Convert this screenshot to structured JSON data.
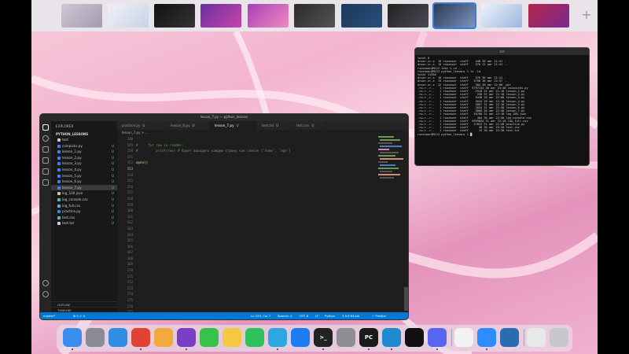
{
  "spaces": {
    "add_label": "+"
  },
  "terminal": {
    "title": "zsh",
    "lines": [
      "total 0",
      "drwxr-xr-x  16 rsoznoar  staff    448 30 авг 21:41 .",
      "drwxr-xr-x  15 rsoznoar  staff    576 31 авг 21:41 ..",
      "rsoznoar@ML12 test % cd ..",
      "rsoznoar@ML12 python_lessons % ls -la",
      "total 11384",
      "drwxr-xr-x  16 rsoznoar  staff    576 30 авг 21:41 .",
      "drwxr-xr-x  15 rsoznoar  staff   3758 30 авг 22:57 ..",
      "drwxr-xr-x  12 rsoznoar  staff    384 30 авг 22:08 .git",
      "-rw-r--r--   1 rsoznoar  staff  5797144 30 авг 23:40 coinpicks.py",
      "-rw-r--r--   1 rsoznoar  staff    1918 31 авг 21:18 lesson_1.py",
      "-rw-r--r--   1 rsoznoar  staff     258 31 авг 21:18 lesson_2.py",
      "-rw-r--r--   1 rsoznoar  staff    9448 29 авг 22:08 lesson_3.py",
      "-rw-r--r--   1 rsoznoar  staff    5044 29 авг 22:18 lesson_4.py",
      "-rw-r--r--   1 rsoznoar  staff    5067 31 авг 22:18 lesson_5.py",
      "-rw-r--r--   1 rsoznoar  staff    2834 31 авг 22:58 lesson_6.py",
      "-rw-r--r--   1 rsoznoar  staff    5800 30 авг 22:48 lesson_7.py",
      "-rw-r--r--   1 rsoznoar  staff   16780 31 авг 22:18 log_100.json",
      "-rw-r--r--   1 rsoznoar  staff     404 30 авг 22:58 log_console.csv",
      "-rw-r--r--   1 rsoznoar  staff  9999826 31 авг 22:18 log_full.csv",
      "-rw-r--r--   1 rsoznoar  staff   27022 31 авг 22:38 practice.py",
      "-rw-r--r--   1 rsoznoar  staff      48 30 авг 23:20 test.csv",
      "-rw-r--r--   1 rsoznoar  staff      15 30 авг 22:38 test.txt",
      "rsoznoar@ML12 python_lessons % █"
    ]
  },
  "vscode": {
    "title": "lesson_7.py — python_lessons",
    "sidebar_header": "EXPLORER",
    "project": "PYTHON_LESSONS",
    "files": [
      {
        "name": "test",
        "badge": "",
        "color": "#cfcfcf"
      },
      {
        "name": "coinpicks.py",
        "badge": "U",
        "color": "#3b82f6"
      },
      {
        "name": "lesson_1.py",
        "badge": "U",
        "color": "#3b82f6"
      },
      {
        "name": "lesson_2.py",
        "badge": "U",
        "color": "#3b82f6"
      },
      {
        "name": "lesson_3.py",
        "badge": "U",
        "color": "#3b82f6"
      },
      {
        "name": "lesson_4.py",
        "badge": "U",
        "color": "#3b82f6"
      },
      {
        "name": "lesson_5.py",
        "badge": "U",
        "color": "#3b82f6"
      },
      {
        "name": "lesson_6.py",
        "badge": "U",
        "color": "#3b82f6"
      },
      {
        "name": "lesson_7.py",
        "badge": "U",
        "color": "#3b82f6"
      },
      {
        "name": "log_100.json",
        "badge": "U",
        "color": "#e5c07b"
      },
      {
        "name": "log_console.csv",
        "badge": "U",
        "color": "#56b6c2"
      },
      {
        "name": "log_full.csv",
        "badge": "U",
        "color": "#56b6c2"
      },
      {
        "name": "practice.py",
        "badge": "U",
        "color": "#3b82f6"
      },
      {
        "name": "test.csv",
        "badge": "U",
        "color": "#56b6c2"
      },
      {
        "name": "test.txt",
        "badge": "U",
        "color": "#cfcfcf"
      }
    ],
    "outline": "OUTLINE",
    "timeline": "TIMELINE",
    "tabs": [
      {
        "label": "practice.py",
        "badge": "U"
      },
      {
        "label": "lesson_6.py",
        "badge": "U"
      },
      {
        "label": "lesson_7.py",
        "badge": "U"
      },
      {
        "label": "test.txt",
        "badge": "U"
      },
      {
        "label": "test.csv",
        "badge": "U"
      }
    ],
    "breadcrumb": "lesson_7.py > ...",
    "line_numbers": [
      "148",
      "149",
      "150",
      "151",
      "152",
      "153",
      "154",
      "155",
      "156",
      "157",
      "158",
      "159",
      "160",
      "161",
      "162",
      "163",
      "164",
      "165",
      "166",
      "167",
      "168",
      "169",
      "170",
      "171",
      "172",
      "173",
      "174",
      "175",
      "176",
      "177",
      "178",
      "179"
    ],
    "code": [
      {
        "text": "#     for row in reader:",
        "kind": "cm"
      },
      {
        "text": "#         print(row) # будет выводить каждую строку как список ['name', 'age']",
        "kind": "cm"
      },
      {
        "text": "",
        "kind": ""
      },
      {
        "text": "open()",
        "kind": "fn"
      }
    ],
    "status": {
      "branch": "master*",
      "errors": "⊗ 0 ⚠ 0",
      "position": "Ln 153, Col 7",
      "spaces": "Spaces: 4",
      "encoding": "UTF-8",
      "eol": "LF",
      "language": "Python",
      "interpreter": "3.9.6 64-bit",
      "prettier": "✓ Prettier"
    }
  },
  "dock": {
    "apps": [
      {
        "name": "finder",
        "color": "#3a8ef0",
        "label": ""
      },
      {
        "name": "launchpad",
        "color": "#8b8b95",
        "label": ""
      },
      {
        "name": "safari",
        "color": "#2f8de4",
        "label": ""
      },
      {
        "name": "chrome",
        "color": "#e34133",
        "label": ""
      },
      {
        "name": "photos",
        "color": "#f3a93b",
        "label": ""
      },
      {
        "name": "visual-studio",
        "color": "#7a3fc4",
        "label": ""
      },
      {
        "name": "facetime",
        "color": "#37c24a",
        "label": ""
      },
      {
        "name": "notes",
        "color": "#f4c842",
        "label": ""
      },
      {
        "name": "whatsapp",
        "color": "#2ec05a",
        "label": ""
      },
      {
        "name": "telegram",
        "color": "#2ea6e0",
        "label": ""
      },
      {
        "name": "app-store",
        "color": "#1e7cf2",
        "label": ""
      },
      {
        "name": "terminal",
        "color": "#222222",
        "label": ">_"
      },
      {
        "name": "system-preferences",
        "color": "#8e8e93",
        "label": ""
      },
      {
        "name": "pycharm",
        "color": "#1a1a1a",
        "label": "PC"
      },
      {
        "name": "vscode",
        "color": "#1f8ad2",
        "label": ""
      },
      {
        "name": "alien-app",
        "color": "#111111",
        "label": ""
      },
      {
        "name": "discord",
        "color": "#5865f2",
        "label": ""
      },
      {
        "name": "file-doc",
        "color": "#f2f2f2",
        "label": ""
      },
      {
        "name": "zoom",
        "color": "#2d8cff",
        "label": ""
      },
      {
        "name": "screen-app",
        "color": "#2b6cb0",
        "label": ""
      },
      {
        "name": "document",
        "color": "#e8e8e8",
        "label": ""
      },
      {
        "name": "trash",
        "color": "#c8c8cc",
        "label": ""
      }
    ]
  }
}
